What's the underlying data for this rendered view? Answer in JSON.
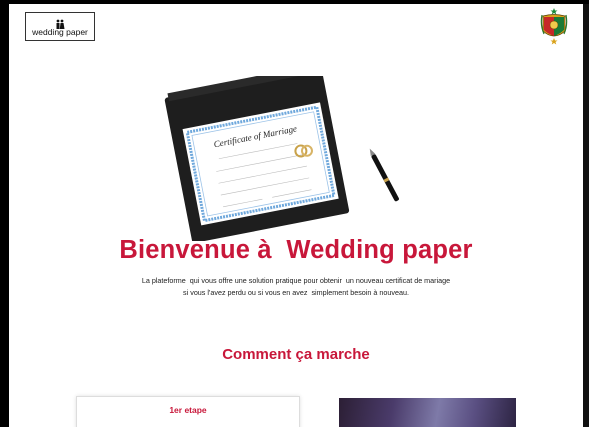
{
  "header": {
    "logo_text": "wedding paper",
    "logo_icon": "couple-icon",
    "emblem_icon": "coat-of-arms-icon"
  },
  "hero": {
    "image": "marriage-certificate-image",
    "certificate_text": "Certificate of Marriage",
    "title": "Bienvenue à  Wedding paper",
    "subtitle_line1": "La plateforme  qui vous offre une solution pratique pour obtenir  un nouveau certificat de mariage",
    "subtitle_line2": "si vous l'avez perdu ou si vous en avez  simplement besoin à nouveau."
  },
  "how_it_works": {
    "title": "Comment ça marche",
    "step1_title": "1er etape"
  },
  "colors": {
    "accent": "#c8173a",
    "certificate_border": "#6fa8dc",
    "folder": "#1e1e1e"
  }
}
